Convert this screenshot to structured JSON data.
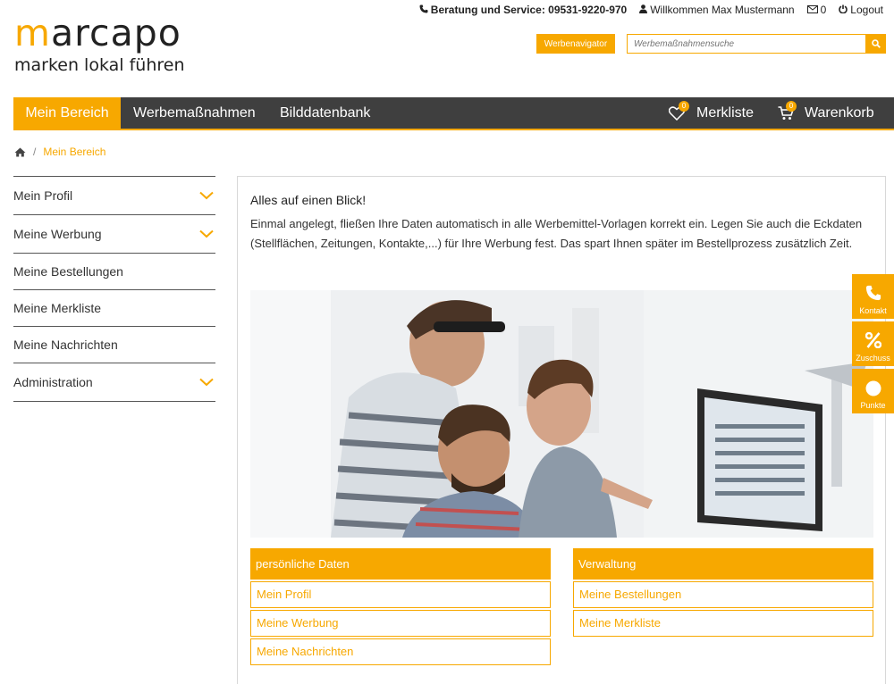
{
  "brand": {
    "name": "marcapo",
    "tagline": "marken lokal führen"
  },
  "topbar": {
    "phone": "Beratung und Service: 09531-9220-970",
    "welcome": "Willkommen Max Mustermann",
    "messages_count": "0",
    "logout": "Logout"
  },
  "header": {
    "navigator_label": "Werbenavigator",
    "search_placeholder": "Werbemaßnahmensuche"
  },
  "mainnav": {
    "items": [
      "Mein Bereich",
      "Werbemaßnahmen",
      "Bilddatenbank"
    ],
    "merkliste": {
      "label": "Merkliste",
      "badge": "0"
    },
    "warenkorb": {
      "label": "Warenkorb",
      "badge": "0"
    }
  },
  "breadcrumb": {
    "separator": "/",
    "current": "Mein Bereich"
  },
  "sidebar": {
    "items": [
      {
        "label": "Mein Profil",
        "expandable": true
      },
      {
        "label": "Meine Werbung",
        "expandable": true
      },
      {
        "label": "Meine Bestellungen",
        "expandable": false
      },
      {
        "label": "Meine Merkliste",
        "expandable": false
      },
      {
        "label": "Meine Nachrichten",
        "expandable": false
      },
      {
        "label": "Administration",
        "expandable": true
      }
    ]
  },
  "content": {
    "title": "Alles auf einen Blick!",
    "text": "Einmal angelegt, fließen Ihre Daten automatisch in alle Werbemittel-Vorlagen korrekt ein. Legen Sie auch die Eckdaten (Stellflächen, Zeitungen, Kontakte,...) für Ihre Werbung fest. Das spart Ihnen später im Bestellprozess zusätzlich Zeit."
  },
  "panels": [
    {
      "title": "persönliche Daten",
      "links": [
        "Mein Profil",
        "Meine Werbung",
        "Meine Nachrichten"
      ]
    },
    {
      "title": "Verwaltung",
      "links": [
        "Meine Bestellungen",
        "Meine Merkliste"
      ]
    }
  ],
  "floaters": [
    "Kontakt",
    "Zuschuss",
    "Punkte"
  ],
  "colors": {
    "accent": "#f7a800",
    "nav_bg": "#3f3f3f",
    "text": "#333333"
  }
}
